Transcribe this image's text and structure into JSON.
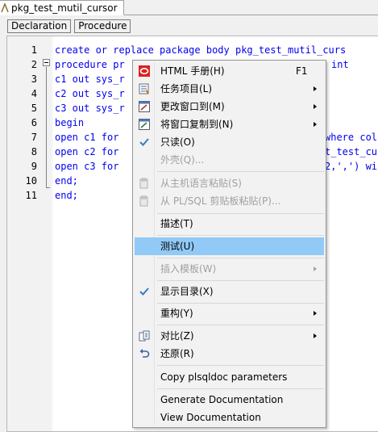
{
  "tab": {
    "title": "pkg_test_mutil_cursor"
  },
  "subtabs": [
    "Declaration",
    "Procedure"
  ],
  "line_numbers": [
    "1",
    "2",
    "3",
    "4",
    "5",
    "6",
    "7",
    "8",
    "9",
    "10",
    "11"
  ],
  "code": {
    "l1": "create or replace package body pkg_test_mutil_curs",
    "l2a": "procedure pr",
    "l2b": "int",
    "l3": "c1 out sys_r",
    "l4": "c2 out sys_r",
    "l5": "c3 out sys_r",
    "l6": "begin",
    "l7a": "open c1 for",
    "l7b": "where col",
    "l8a": "open c2 for",
    "l8b": "t_test_cu",
    "l9a": "open c3 for",
    "l9b": "2,',') wi",
    "l10": "end;",
    "l11": "end;"
  },
  "menu": {
    "items": [
      {
        "label": "HTML 手册(H)",
        "shortcut": "F1",
        "icon": "html-help-icon"
      },
      {
        "label": "任务项目(L)",
        "icon": "task-icon"
      },
      {
        "label": "更改窗口到(M)",
        "icon": "window-change-icon"
      },
      {
        "label": "将窗口复制到(N)",
        "icon": "window-copy-icon"
      },
      {
        "label": "只读(O)",
        "icon": "checkmark-icon"
      },
      {
        "label": "外壳(Q)..."
      },
      {
        "label": "从主机语言粘贴(S)",
        "icon": "paste-icon"
      },
      {
        "label": "从 PL/SQL 剪贴板粘贴(P)...",
        "icon": "paste-icon"
      },
      {
        "label": "描述(T)"
      },
      {
        "label": "测试(U)"
      },
      {
        "label": "插入模板(W)"
      },
      {
        "label": "显示目录(X)",
        "icon": "checkmark-icon"
      },
      {
        "label": "重构(Y)"
      },
      {
        "label": "对比(Z)",
        "icon": "compare-icon"
      },
      {
        "label": "还原(R)",
        "icon": "undo-icon"
      },
      {
        "label": "Copy plsqldoc parameters"
      },
      {
        "label": "Generate Documentation"
      },
      {
        "label": "View Documentation"
      }
    ]
  },
  "colors": {
    "highlight": "#91c9f7",
    "code_blue": "#0000ee",
    "check_blue": "#3d78c9"
  }
}
